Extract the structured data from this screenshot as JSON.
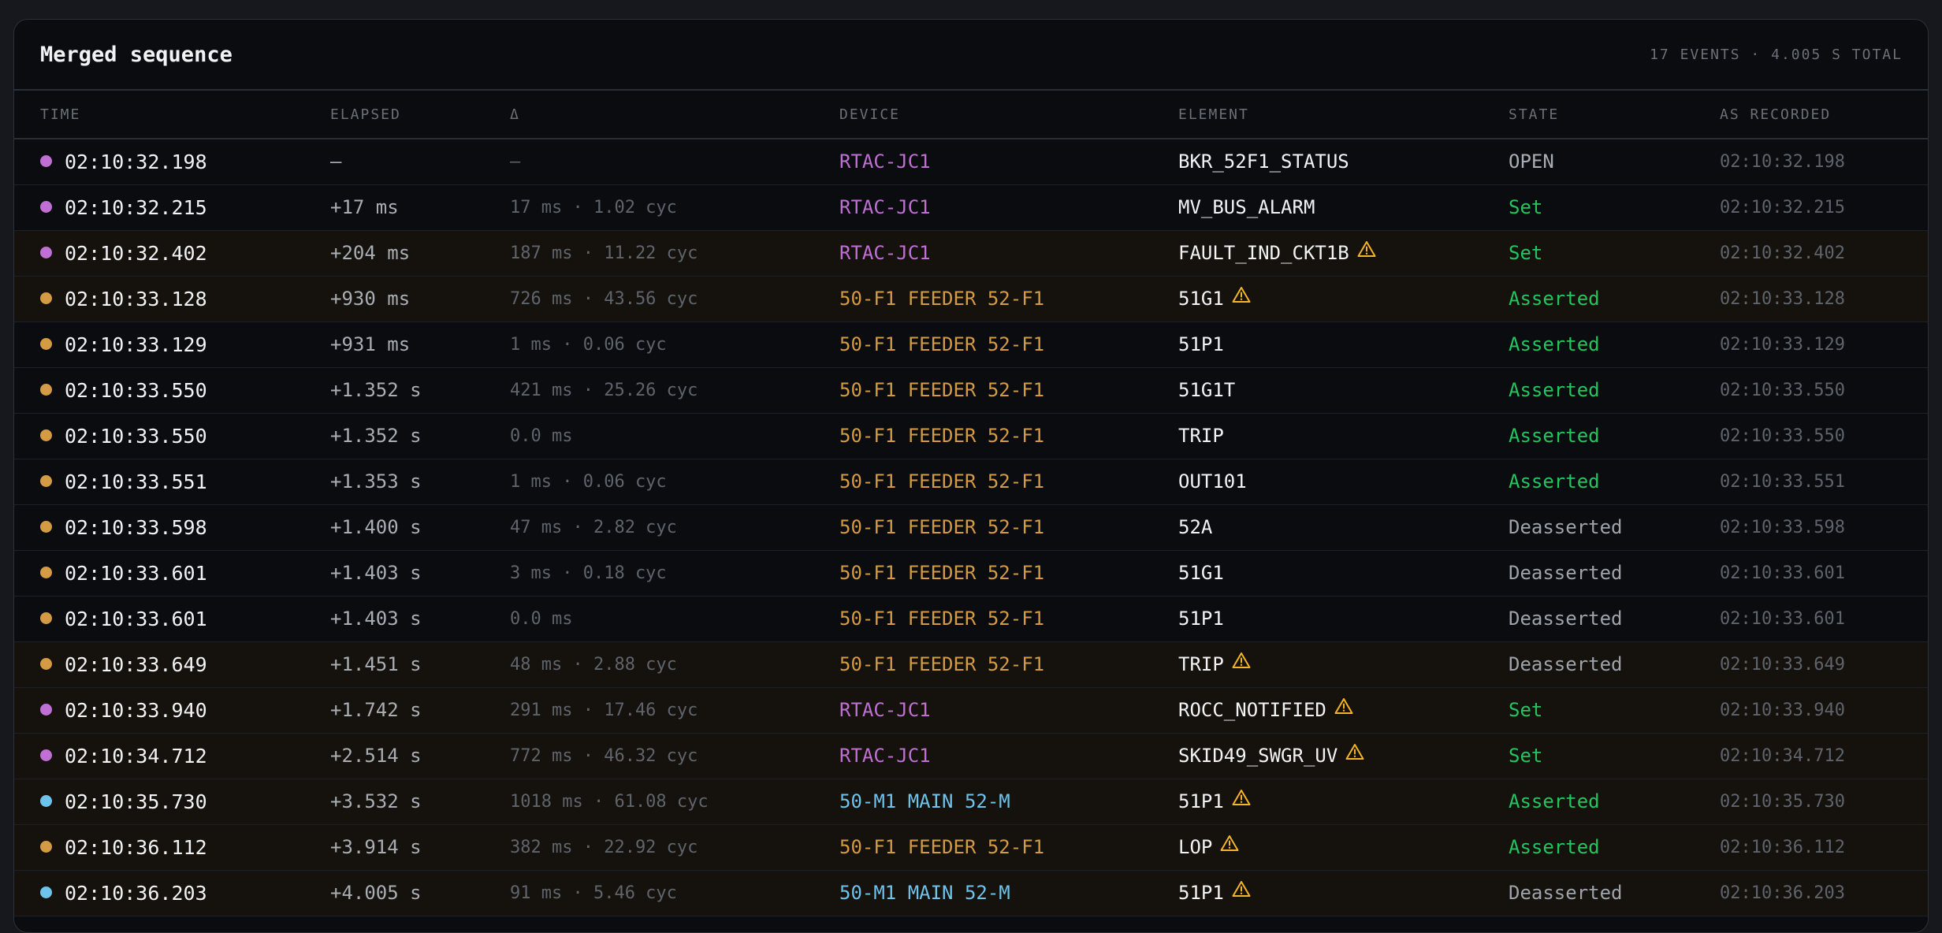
{
  "header": {
    "title": "Merged sequence",
    "summary": "17 EVENTS · 4.005 S TOTAL"
  },
  "columns": {
    "time": "TIME",
    "elapsed": "ELAPSED",
    "delta": "Δ",
    "device": "DEVICE",
    "element": "ELEMENT",
    "state": "STATE",
    "recorded": "AS RECORDED"
  },
  "device_colors": {
    "RTAC-JC1": "#c06fd4",
    "50-F1 FEEDER 52-F1": "#d49a44",
    "50-M1 MAIN 52-M": "#6ec3ec"
  },
  "warning_color": "#f5b524",
  "rows": [
    {
      "time": "02:10:32.198",
      "elapsed": "—",
      "delta": "—",
      "device": "RTAC-JC1",
      "element": "BKR_52F1_STATUS",
      "warn": false,
      "state": "OPEN",
      "recorded": "02:10:32.198",
      "highlight": false
    },
    {
      "time": "02:10:32.215",
      "elapsed": "+17 ms",
      "delta": "17 ms · 1.02 cyc",
      "device": "RTAC-JC1",
      "element": "MV_BUS_ALARM",
      "warn": false,
      "state": "Set",
      "recorded": "02:10:32.215",
      "highlight": false
    },
    {
      "time": "02:10:32.402",
      "elapsed": "+204 ms",
      "delta": "187 ms · 11.22 cyc",
      "device": "RTAC-JC1",
      "element": "FAULT_IND_CKT1B",
      "warn": true,
      "state": "Set",
      "recorded": "02:10:32.402",
      "highlight": true
    },
    {
      "time": "02:10:33.128",
      "elapsed": "+930 ms",
      "delta": "726 ms · 43.56 cyc",
      "device": "50-F1 FEEDER 52-F1",
      "element": "51G1",
      "warn": true,
      "state": "Asserted",
      "recorded": "02:10:33.128",
      "highlight": true
    },
    {
      "time": "02:10:33.129",
      "elapsed": "+931 ms",
      "delta": "1 ms · 0.06 cyc",
      "device": "50-F1 FEEDER 52-F1",
      "element": "51P1",
      "warn": false,
      "state": "Asserted",
      "recorded": "02:10:33.129",
      "highlight": false
    },
    {
      "time": "02:10:33.550",
      "elapsed": "+1.352 s",
      "delta": "421 ms · 25.26 cyc",
      "device": "50-F1 FEEDER 52-F1",
      "element": "51G1T",
      "warn": false,
      "state": "Asserted",
      "recorded": "02:10:33.550",
      "highlight": false
    },
    {
      "time": "02:10:33.550",
      "elapsed": "+1.352 s",
      "delta": "0.0 ms",
      "device": "50-F1 FEEDER 52-F1",
      "element": "TRIP",
      "warn": false,
      "state": "Asserted",
      "recorded": "02:10:33.550",
      "highlight": false
    },
    {
      "time": "02:10:33.551",
      "elapsed": "+1.353 s",
      "delta": "1 ms · 0.06 cyc",
      "device": "50-F1 FEEDER 52-F1",
      "element": "OUT101",
      "warn": false,
      "state": "Asserted",
      "recorded": "02:10:33.551",
      "highlight": false
    },
    {
      "time": "02:10:33.598",
      "elapsed": "+1.400 s",
      "delta": "47 ms · 2.82 cyc",
      "device": "50-F1 FEEDER 52-F1",
      "element": "52A",
      "warn": false,
      "state": "Deasserted",
      "recorded": "02:10:33.598",
      "highlight": false
    },
    {
      "time": "02:10:33.601",
      "elapsed": "+1.403 s",
      "delta": "3 ms · 0.18 cyc",
      "device": "50-F1 FEEDER 52-F1",
      "element": "51G1",
      "warn": false,
      "state": "Deasserted",
      "recorded": "02:10:33.601",
      "highlight": false
    },
    {
      "time": "02:10:33.601",
      "elapsed": "+1.403 s",
      "delta": "0.0 ms",
      "device": "50-F1 FEEDER 52-F1",
      "element": "51P1",
      "warn": false,
      "state": "Deasserted",
      "recorded": "02:10:33.601",
      "highlight": false
    },
    {
      "time": "02:10:33.649",
      "elapsed": "+1.451 s",
      "delta": "48 ms · 2.88 cyc",
      "device": "50-F1 FEEDER 52-F1",
      "element": "TRIP",
      "warn": true,
      "state": "Deasserted",
      "recorded": "02:10:33.649",
      "highlight": true
    },
    {
      "time": "02:10:33.940",
      "elapsed": "+1.742 s",
      "delta": "291 ms · 17.46 cyc",
      "device": "RTAC-JC1",
      "element": "ROCC_NOTIFIED",
      "warn": true,
      "state": "Set",
      "recorded": "02:10:33.940",
      "highlight": true
    },
    {
      "time": "02:10:34.712",
      "elapsed": "+2.514 s",
      "delta": "772 ms · 46.32 cyc",
      "device": "RTAC-JC1",
      "element": "SKID49_SWGR_UV",
      "warn": true,
      "state": "Set",
      "recorded": "02:10:34.712",
      "highlight": true
    },
    {
      "time": "02:10:35.730",
      "elapsed": "+3.532 s",
      "delta": "1018 ms · 61.08 cyc",
      "device": "50-M1 MAIN 52-M",
      "element": "51P1",
      "warn": true,
      "state": "Asserted",
      "recorded": "02:10:35.730",
      "highlight": true
    },
    {
      "time": "02:10:36.112",
      "elapsed": "+3.914 s",
      "delta": "382 ms · 22.92 cyc",
      "device": "50-F1 FEEDER 52-F1",
      "element": "LOP",
      "warn": true,
      "state": "Asserted",
      "recorded": "02:10:36.112",
      "highlight": true
    },
    {
      "time": "02:10:36.203",
      "elapsed": "+4.005 s",
      "delta": "91 ms · 5.46 cyc",
      "device": "50-M1 MAIN 52-M",
      "element": "51P1",
      "warn": true,
      "state": "Deasserted",
      "recorded": "02:10:36.203",
      "highlight": true
    }
  ]
}
